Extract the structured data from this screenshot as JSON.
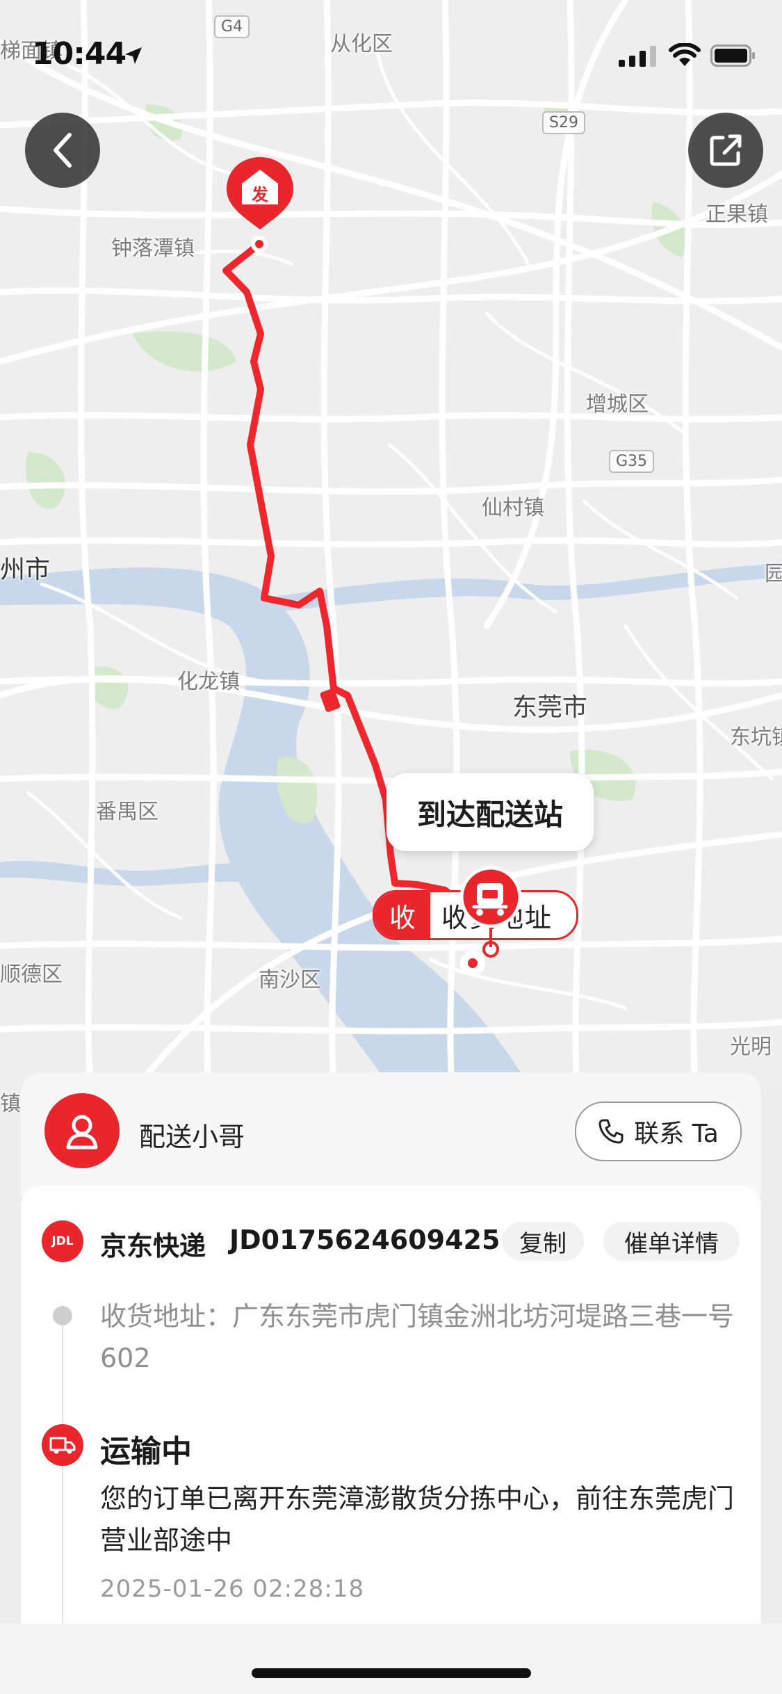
{
  "status_bar": {
    "time": "10:44"
  },
  "map": {
    "place_labels": [
      {
        "id": "conghua",
        "text": "从化区"
      },
      {
        "id": "zhongluotan",
        "text": "钟落潭镇"
      },
      {
        "id": "zhengguo",
        "text": "正果镇"
      },
      {
        "id": "zengcheng",
        "text": "增城区"
      },
      {
        "id": "xiancun",
        "text": "仙村镇"
      },
      {
        "id": "zhoushi",
        "text": "州市"
      },
      {
        "id": "hualong",
        "text": "化龙镇"
      },
      {
        "id": "dongguan",
        "text": "东莞市"
      },
      {
        "id": "dongkeng",
        "text": "东坑镇"
      },
      {
        "id": "panyu",
        "text": "番禺区"
      },
      {
        "id": "shunde",
        "text": "顺德区"
      },
      {
        "id": "nansha",
        "text": "南沙区"
      },
      {
        "id": "guangming",
        "text": "光明"
      },
      {
        "id": "timian",
        "text": "梯面镇"
      },
      {
        "id": "yuan",
        "text": "园"
      },
      {
        "id": "zhen",
        "text": "镇"
      }
    ],
    "road_shields": [
      {
        "id": "g4",
        "text": "G4"
      },
      {
        "id": "s29",
        "text": "S29"
      },
      {
        "id": "g35",
        "text": "G35"
      }
    ],
    "sender_marker_label": "发",
    "arrival_bubble": "到达配送站",
    "receiver_tag_prefix": "收",
    "receiver_tag_text": "收货地址"
  },
  "courier": {
    "title": "配送小哥",
    "contact_label": "联系 Ta"
  },
  "tracking": {
    "carrier_logo": "JDL",
    "carrier_name": "京东快递",
    "number": "JD0175624609425",
    "copy_label": "复制",
    "urge_label": "催单详情",
    "address": "收货地址：广东东莞市虎门镇金洲北坊河堤路三巷一号602",
    "status_title": "运输中",
    "status_detail": "您的订单已离开东莞漳澎散货分拣中心，前往东莞虎门营业部途中",
    "status_time": "2025-01-26 02:28:18"
  },
  "colors": {
    "brand_red": "#e8262c",
    "route_red": "#f0262d"
  }
}
